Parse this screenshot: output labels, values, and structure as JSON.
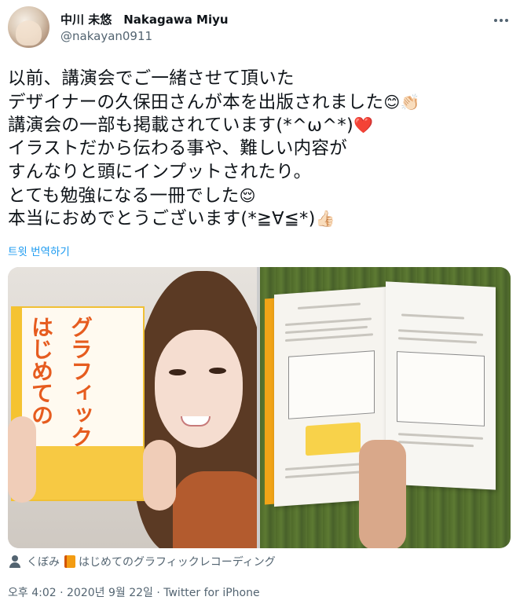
{
  "header": {
    "display_name": "中川 未悠　Nakagawa Miyu",
    "username": "@nakayan0911",
    "more_icon": "more-horizontal-icon"
  },
  "tweet": {
    "lines": [
      "以前、講演会でご一緒させて頂いた",
      "デザイナーの久保田さんが本を出版されました",
      "講演会の一部も掲載されています(*^ω^*)",
      "イラストだから伝わる事や、難しい内容が",
      "すんなりと頭にインプットされたり。",
      "とても勉強になる一冊でした",
      "本当におめでとうございます(*≧∀≦*)"
    ],
    "emojis": {
      "smile": "😊",
      "clap": "👏🏻",
      "heart": "❤️",
      "relieved": "😌",
      "thumbs_up": "👍🏻"
    }
  },
  "translate_label": "트윗 번역하기",
  "media": {
    "photo_left_book_title": "はじめてのグラフィックレコーディング",
    "photo_right_alt": "open book"
  },
  "tags": {
    "person": "くぼみ",
    "book": "はじめてのグラフィックレコーディング"
  },
  "meta": {
    "text": "오후 4:02 · 2020년 9월 22일 · Twitter for iPhone"
  }
}
